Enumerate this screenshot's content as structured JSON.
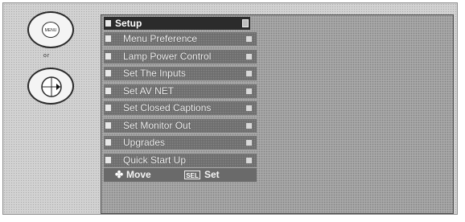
{
  "remote": {
    "menu_button_label": "MENU",
    "separator_text": "or"
  },
  "menu": {
    "title": "Setup",
    "items": [
      {
        "label": "Menu Preference"
      },
      {
        "label": "Lamp Power Control"
      },
      {
        "label": "Set The Inputs"
      },
      {
        "label": "Set AV NET"
      },
      {
        "label": "Set Closed Captions"
      },
      {
        "label": "Set Monitor Out"
      },
      {
        "label": "Upgrades"
      },
      {
        "label": "Quick Start Up"
      }
    ]
  },
  "footer": {
    "move_label": "Move",
    "move_icon": "✤",
    "enter_key_label": "SEL",
    "set_label": "Set"
  },
  "colors": {
    "background": "#d2d2d2",
    "panel": "#a8a8a8",
    "highlight": "#2b2b2b",
    "item": "#6e6e6e"
  }
}
